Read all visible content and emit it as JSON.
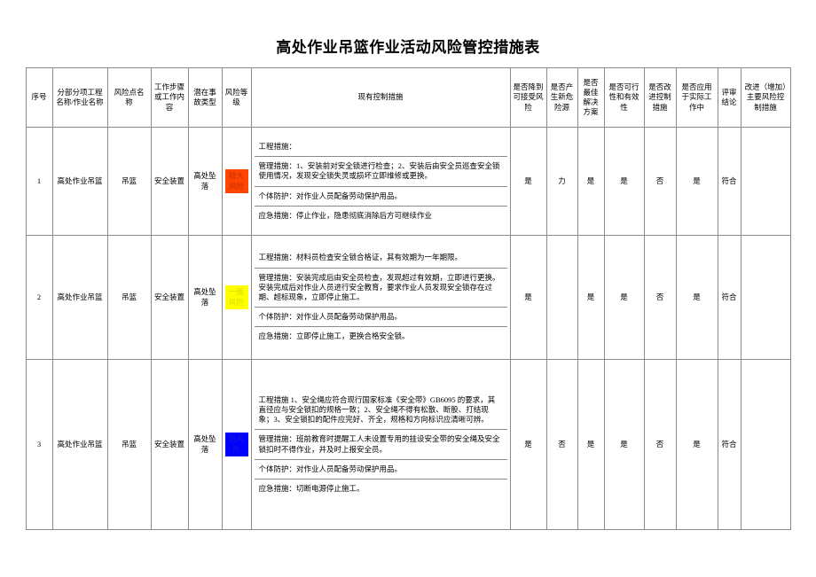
{
  "document": {
    "title": "高处作业吊篮作业活动风险管控措施表"
  },
  "table": {
    "headers": {
      "seq": "序号",
      "project": "分部分项工程名称/作业名称",
      "risk_point": "风险点名称",
      "work_step": "工作步骤或工作内容",
      "accident_type": "潜在事故类型",
      "risk_level": "风险等级",
      "existing_measures": "现有控制措施",
      "q1_acceptable": "是否降到可接受风险",
      "q2_new_hazard": "是否产生新危险源",
      "q3_best_solution": "是否最佳解决方案",
      "q4_feasible": "是否可行性和有效性",
      "q5_improve_control": "是否改进控制措施",
      "q6_applied_actual": "是否应用于实际工作中",
      "q7_review": "评审结论",
      "improvement": "改进（增加）主要风险控制措施"
    },
    "rows": [
      {
        "seq": "1",
        "project": "高处作业吊篮",
        "risk_point": "吊篮",
        "work_step": "安全装置",
        "accident_type": "高处坠落",
        "risk_level": "较大风险",
        "risk_class": "risk-high",
        "row_class": "row1-h",
        "measures": [
          "工程措施：",
          "管理措施：1、安装前对安全锁进行检查；2、安装后由安全员巡查安全锁使用情况，发现安全锁失灵或损坏立即维修或更换。",
          "个体防护：对作业人员配备劳动保护用品。",
          "应急措施：停止作业，隐患彻底消除后方可继续作业"
        ],
        "q1_acceptable": "是",
        "q2_new_hazard": "力",
        "q3_best_solution": "是",
        "q4_feasible": "是",
        "q5_improve_control": "否",
        "q6_applied_actual": "是",
        "q7_review": "符合",
        "improvement": ""
      },
      {
        "seq": "2",
        "project": "高处作业吊篮",
        "risk_point": "吊篮",
        "work_step": "安全装置",
        "accident_type": "高处坠落",
        "risk_level": "一般风险",
        "risk_class": "risk-medium",
        "row_class": "row2-h",
        "measures": [
          "工程措施：材料员检查安全锁合格证，其有效期为一年期限。",
          "管理措施：安装完成后由安全员检查，发现超过有效期，立即进行更换。安装完成后对作业人员进行安全教育，要求作业人员发现安全锁存在过期、超标现象，立即停止施工。",
          "个体防护：对作业人员配备劳动保护用品。",
          "应急措施：立即停止施工，更换合格安全锁。"
        ],
        "q1_acceptable": "是",
        "q2_new_hazard": "",
        "q3_best_solution": "是",
        "q4_feasible": "是",
        "q5_improve_control": "否",
        "q6_applied_actual": "是",
        "q7_review": "符合",
        "improvement": ""
      },
      {
        "seq": "3",
        "project": "高处作业吊篮",
        "risk_point": "吊篮",
        "work_step": "安全装置",
        "accident_type": "高处坠落",
        "risk_level": "低风险",
        "risk_class": "risk-low",
        "row_class": "row3-h",
        "measures": [
          "工程措施 1、安全绳应符合现行国家标准《安全带》GB6095 的要求，其直径应与安全锁扣的规格一致；2、安全绳不得有松散、断股、打结现象；3、安全锁扣的配件应完好、齐全，规格和方向标识应清晰可辨。",
          "管理措施：班前教育时提醒工人未设置专用的挂设安全带的安全绳及安全锁扣时不得作业，并及时上报安全员。",
          "个体防护：对作业人员配备劳动保护用品。",
          "应急措施：切断电源停止施工。"
        ],
        "q1_acceptable": "是",
        "q2_new_hazard": "否",
        "q3_best_solution": "是",
        "q4_feasible": "是",
        "q5_improve_control": "否",
        "q6_applied_actual": "是",
        "q7_review": "符合",
        "improvement": ""
      }
    ]
  }
}
